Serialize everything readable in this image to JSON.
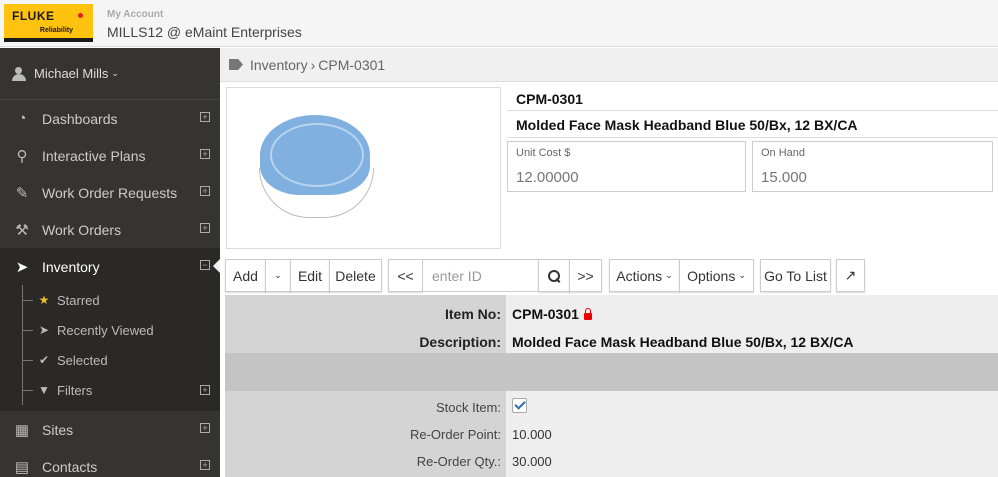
{
  "header": {
    "logo_brand": "FLUKE",
    "logo_sub": "Reliability",
    "account_label": "My Account",
    "account_name": "MILLS12 @ eMaint Enterprises"
  },
  "sidebar": {
    "user": "Michael Mills",
    "items": [
      {
        "label": "Dashboards",
        "icon": "dashboard-icon"
      },
      {
        "label": "Interactive Plans",
        "icon": "map-marker-icon"
      },
      {
        "label": "Work Order Requests",
        "icon": "pencil-icon"
      },
      {
        "label": "Work Orders",
        "icon": "wrench-icon"
      },
      {
        "label": "Inventory",
        "icon": "tag-icon"
      },
      {
        "label": "Sites",
        "icon": "table-icon"
      },
      {
        "label": "Contacts",
        "icon": "contact-icon"
      }
    ],
    "sub_items": [
      {
        "label": "Starred",
        "icon": "star-icon"
      },
      {
        "label": "Recently Viewed",
        "icon": "send-icon"
      },
      {
        "label": "Selected",
        "icon": "check-icon"
      },
      {
        "label": "Filters",
        "icon": "filter-icon"
      }
    ]
  },
  "breadcrumb": {
    "section": "Inventory",
    "separator": "›",
    "item": "CPM-0301"
  },
  "item": {
    "id": "CPM-0301",
    "description": "Molded Face Mask Headband Blue 50/Bx, 12 BX/CA",
    "unit_cost_label": "Unit Cost $",
    "unit_cost": "12.00000",
    "on_hand_label": "On Hand",
    "on_hand": "15.000"
  },
  "toolbar": {
    "add": "Add",
    "edit": "Edit",
    "delete": "Delete",
    "prev": "<<",
    "search_placeholder": "enter ID",
    "next": ">>",
    "actions": "Actions",
    "options": "Options",
    "goto_list": "Go To List"
  },
  "form": {
    "item_no_label": "Item No:",
    "item_no": "CPM-0301",
    "description_label": "Description:",
    "description": "Molded Face Mask Headband Blue 50/Bx, 12 BX/CA",
    "stock_item_label": "Stock Item:",
    "stock_item": true,
    "reorder_point_label": "Re-Order Point:",
    "reorder_point": "10.000",
    "reorder_qty_label": "Re-Order Qty.:",
    "reorder_qty": "30.000"
  }
}
